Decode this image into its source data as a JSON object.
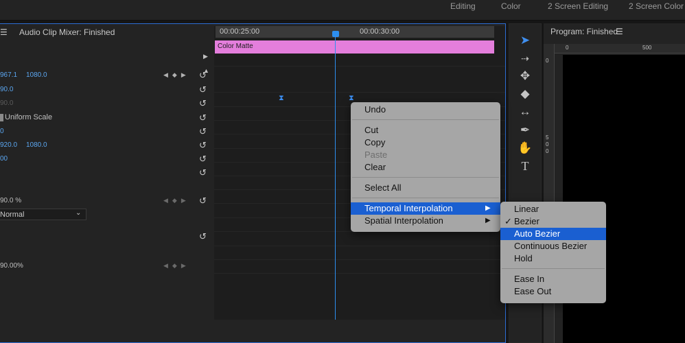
{
  "workspaces": [
    "Editing",
    "Color",
    "2 Screen Editing",
    "2 Screen Color"
  ],
  "left_panel": {
    "title": "Audio Clip Mixer: Finished",
    "rows": [
      {
        "v1": "967.1",
        "v2": "1080.0"
      },
      {
        "v1": "90.0"
      },
      {
        "v1": "90.0"
      },
      {
        "label": "Uniform Scale"
      },
      {
        "v1": "0"
      },
      {
        "v1": "920.0",
        "v2": "1080.0"
      },
      {
        "v1": "00"
      },
      {
        "v1": "90.0 %"
      },
      {
        "v1": "Normal"
      },
      {
        "v1": "90.00%"
      }
    ]
  },
  "timeline": {
    "ruler": [
      "00:00:25:00",
      "00:00:30:00"
    ],
    "clip_label": "Color Matte"
  },
  "program": {
    "title": "Program: Finished",
    "ruler_h": [
      "0",
      "500"
    ],
    "ruler_v": [
      "0",
      "5",
      "0",
      "0"
    ]
  },
  "context_menu": {
    "items": [
      "Undo",
      "Cut",
      "Copy",
      "Paste",
      "Clear",
      "Select All",
      "Temporal Interpolation",
      "Spatial Interpolation"
    ]
  },
  "submenu": {
    "items": [
      "Linear",
      "Bezier",
      "Auto Bezier",
      "Continuous Bezier",
      "Hold",
      "Ease In",
      "Ease Out"
    ]
  },
  "icons": {
    "reset": "reset-icon",
    "keyframe": "keyframe-icon",
    "selection": "selection-tool-icon",
    "track_select": "track-select-tool-icon",
    "ripple": "ripple-edit-tool-icon",
    "razor": "razor-tool-icon",
    "slip": "slip-tool-icon",
    "pen": "pen-tool-icon",
    "hand": "hand-tool-icon",
    "type": "type-tool-icon"
  },
  "colors": {
    "accent": "#2d8ff0",
    "clip": "#e47edc",
    "menu_highlight": "#1a5fd1"
  }
}
